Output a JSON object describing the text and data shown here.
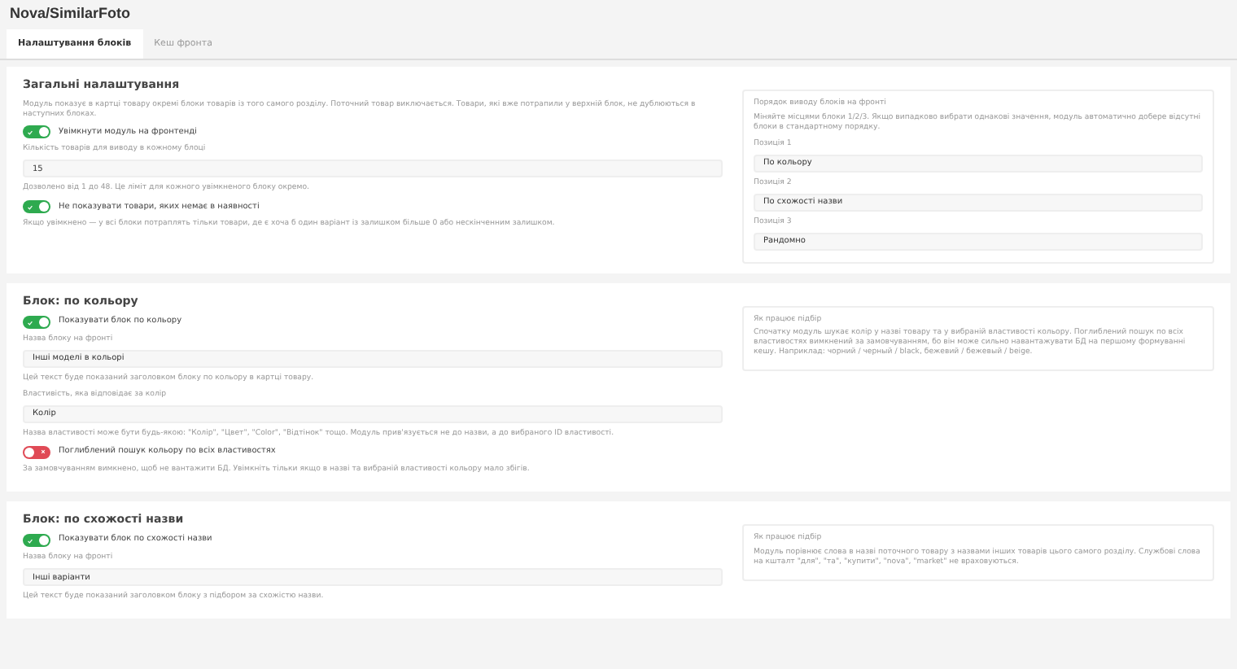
{
  "title": "Nova/SimilarFoto",
  "tabs": [
    {
      "label": "Налаштування блоків",
      "selected": true
    },
    {
      "label": "Кеш фронта",
      "selected": false
    }
  ],
  "sections": [
    {
      "heading": "Загальні налаштування",
      "items": [
        {
          "kind": "note",
          "text": "Модуль показує в картці товару окремі блоки товарів із того самого розділу. Поточний товар виключається. Товари, які вже потрапили у верхній блок, не дублюються в наступних блоках."
        },
        {
          "kind": "toggle",
          "label": "Увімкнути модуль на фронтенді",
          "on": true
        },
        {
          "kind": "field",
          "label": "Кількість товарів для виводу в кожному блоці",
          "value": "15"
        },
        {
          "kind": "hint",
          "text": "Дозволено від 1 до 48. Це ліміт для кожного увімкненого блоку окремо."
        },
        {
          "kind": "toggle",
          "label": "Не показувати товари, яких немає в наявності",
          "on": true
        },
        {
          "kind": "hint",
          "text": "Якщо увімкнено — у всі блоки потраплять тільки товари, де є хоча б один варіант із залишком більше 0 або нескінченним залишком."
        }
      ],
      "aside": {
        "title": "Порядок виводу блоків на фронті",
        "text": "Міняйте місцями блоки 1/2/3. Якщо випадково вибрати однакові значення, модуль автоматично добере відсутні блоки в стандартному порядку.",
        "fields": [
          {
            "label": "Позиція 1",
            "value": "По кольору"
          },
          {
            "label": "Позиція 2",
            "value": "По схожості назви"
          },
          {
            "label": "Позиція 3",
            "value": "Рандомно"
          }
        ]
      }
    },
    {
      "heading": "Блок: по кольору",
      "items": [
        {
          "kind": "toggle",
          "label": "Показувати блок по кольору",
          "on": true
        },
        {
          "kind": "field",
          "label": "Назва блоку на фронті",
          "value": "Інші моделі в кольорі"
        },
        {
          "kind": "hint",
          "text": "Цей текст буде показаний заголовком блоку по кольору в картці товару."
        },
        {
          "kind": "field",
          "label": "Властивість, яка відповідає за колір",
          "value": "Колір"
        },
        {
          "kind": "hint",
          "text": "Назва властивості може бути будь-якою: \"Колір\", \"Цвет\", \"Color\", \"Відтінок\" тощо. Модуль прив'язується не до назви, а до вибраного ID властивості."
        },
        {
          "kind": "toggle",
          "label": "Поглиблений пошук кольору по всіх властивостях",
          "on": false
        },
        {
          "kind": "hint",
          "text": "За замовчуванням вимкнено, щоб не вантажити БД. Увімкніть тільки якщо в назві та вибраній властивості кольору мало збігів."
        }
      ],
      "aside": {
        "title": "Як працює підбір",
        "text": "Спочатку модуль шукає колір у назві товару та у вибраній властивості кольору. Поглиблений пошук по всіх властивостях вимкнений за замовчуванням, бо він може сильно навантажувати БД на першому формуванні кешу. Наприклад: чорний / черный / black, бежевий / бежевый / beige."
      }
    },
    {
      "heading": "Блок: по схожості назви",
      "items": [
        {
          "kind": "toggle",
          "label": "Показувати блок по схожості назви",
          "on": true
        },
        {
          "kind": "field",
          "label": "Назва блоку на фронті",
          "value": "Інші варіанти"
        },
        {
          "kind": "hint",
          "text": "Цей текст буде показаний заголовком блоку з підбором за схожістю назви."
        }
      ],
      "aside": {
        "title": "Як працює підбір",
        "text": "Модуль порівнює слова в назві поточного товару з назвами інших товарів цього самого розділу. Службові слова на кшталт \"для\", \"та\", \"купити\", \"nova\", \"market\" не враховуються."
      }
    }
  ]
}
